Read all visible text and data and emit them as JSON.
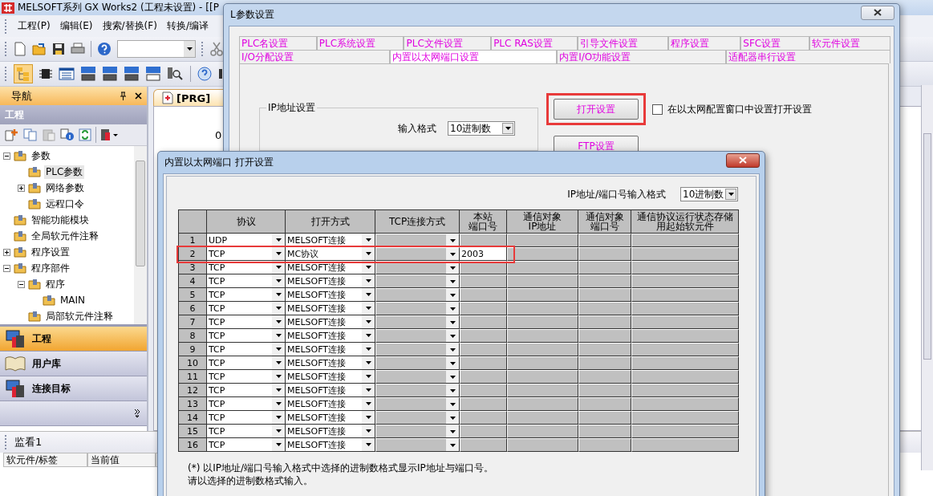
{
  "main_window": {
    "title": "MELSOFT系列 GX Works2 (工程未设置) - [[P",
    "menu": [
      "工程(P)",
      "编辑(E)",
      "搜索/替换(F)",
      "转换/编译"
    ]
  },
  "navigation": {
    "title": "导航",
    "section_title": "工程",
    "tree": [
      {
        "label": "参数",
        "expanded": true,
        "selected": false,
        "children": [
          {
            "label": "PLC参数",
            "selected": true
          },
          {
            "label": "网络参数",
            "expanded": false,
            "selected": false
          },
          {
            "label": "远程口令",
            "selected": false
          }
        ]
      },
      {
        "label": "智能功能模块",
        "selected": false
      },
      {
        "label": "全局软元件注释",
        "selected": false
      },
      {
        "label": "程序设置",
        "expanded": false,
        "selected": false
      },
      {
        "label": "程序部件",
        "expanded": true,
        "selected": false,
        "children": [
          {
            "label": "程序",
            "expanded": true,
            "selected": false,
            "children": [
              {
                "label": "MAIN",
                "selected": false
              }
            ]
          },
          {
            "label": "局部软元件注释",
            "selected": false
          }
        ]
      }
    ],
    "sections": [
      {
        "label": "工程",
        "selected": true
      },
      {
        "label": "用户库",
        "selected": false
      },
      {
        "label": "连接目标",
        "selected": false
      }
    ]
  },
  "editor": {
    "tab": "[PRG]",
    "line_number": "0"
  },
  "monitor": {
    "title": "监看1",
    "columns": [
      "软元件/标签",
      "当前值"
    ]
  },
  "param_dialog": {
    "title": "L参数设置",
    "tab_rows": [
      [
        {
          "label": "PLC名设置",
          "selected": false
        },
        {
          "label": "PLC系统设置",
          "selected": false
        },
        {
          "label": "PLC文件设置",
          "selected": false
        },
        {
          "label": "PLC RAS设置",
          "selected": false
        },
        {
          "label": "引导文件设置",
          "selected": false
        },
        {
          "label": "程序设置",
          "selected": false
        },
        {
          "label": "SFC设置",
          "selected": false
        },
        {
          "label": "软元件设置",
          "selected": false
        }
      ],
      [
        {
          "label": "I/O分配设置",
          "selected": false
        },
        {
          "label": "内置以太网端口设置",
          "selected": true
        },
        {
          "label": "内置I/O功能设置",
          "selected": false
        },
        {
          "label": "适配器串行设置",
          "selected": false
        }
      ]
    ],
    "ip_group": {
      "title": "IP地址设置",
      "input_format_label": "输入格式",
      "input_format": "10进制数"
    },
    "open_settings_button": {
      "label": "打开设置",
      "highlighted": true
    },
    "config_checkbox": {
      "label": "在以太网配置窗口中设置打开设置",
      "checked": false
    },
    "ftp_button": {
      "label": "FTP设置"
    }
  },
  "open_dialog": {
    "title": "内置以太网端口 打开设置",
    "format_label": "IP地址/端口号输入格式",
    "format": "10进制数",
    "columns": [
      [
        "协议"
      ],
      [
        "打开方式"
      ],
      [
        "TCP连接方式"
      ],
      [
        "本站",
        "端口号"
      ],
      [
        "通信对象",
        "IP地址"
      ],
      [
        "通信对象",
        "端口号"
      ],
      [
        "通信协议运行状态存储",
        "用起始软元件"
      ]
    ],
    "rows": [
      {
        "number": "1",
        "protocol": "UDP",
        "open_method": "MELSOFT连接",
        "highlighted": false
      },
      {
        "number": "2",
        "protocol": "TCP",
        "open_method": "MC协议",
        "local_port": "2003",
        "highlighted": true
      },
      {
        "number": "3",
        "protocol": "TCP",
        "open_method": "MELSOFT连接",
        "highlighted": false
      },
      {
        "number": "4",
        "protocol": "TCP",
        "open_method": "MELSOFT连接",
        "highlighted": false
      },
      {
        "number": "5",
        "protocol": "TCP",
        "open_method": "MELSOFT连接",
        "highlighted": false
      },
      {
        "number": "6",
        "protocol": "TCP",
        "open_method": "MELSOFT连接",
        "highlighted": false
      },
      {
        "number": "7",
        "protocol": "TCP",
        "open_method": "MELSOFT连接",
        "highlighted": false
      },
      {
        "number": "8",
        "protocol": "TCP",
        "open_method": "MELSOFT连接",
        "highlighted": false
      },
      {
        "number": "9",
        "protocol": "TCP",
        "open_method": "MELSOFT连接",
        "highlighted": false
      },
      {
        "number": "10",
        "protocol": "TCP",
        "open_method": "MELSOFT连接",
        "highlighted": false
      },
      {
        "number": "11",
        "protocol": "TCP",
        "open_method": "MELSOFT连接",
        "highlighted": false
      },
      {
        "number": "12",
        "protocol": "TCP",
        "open_method": "MELSOFT连接",
        "highlighted": false
      },
      {
        "number": "13",
        "protocol": "TCP",
        "open_method": "MELSOFT连接",
        "highlighted": false
      },
      {
        "number": "14",
        "protocol": "TCP",
        "open_method": "MELSOFT连接",
        "highlighted": false
      },
      {
        "number": "15",
        "protocol": "TCP",
        "open_method": "MELSOFT连接",
        "highlighted": false
      },
      {
        "number": "16",
        "protocol": "TCP",
        "open_method": "MELSOFT连接",
        "highlighted": false
      }
    ],
    "notes": [
      "(*) 以IP地址/端口号输入格式中选择的进制数格式显示IP地址与端口号。",
      "请以选择的进制数格式输入。"
    ]
  }
}
